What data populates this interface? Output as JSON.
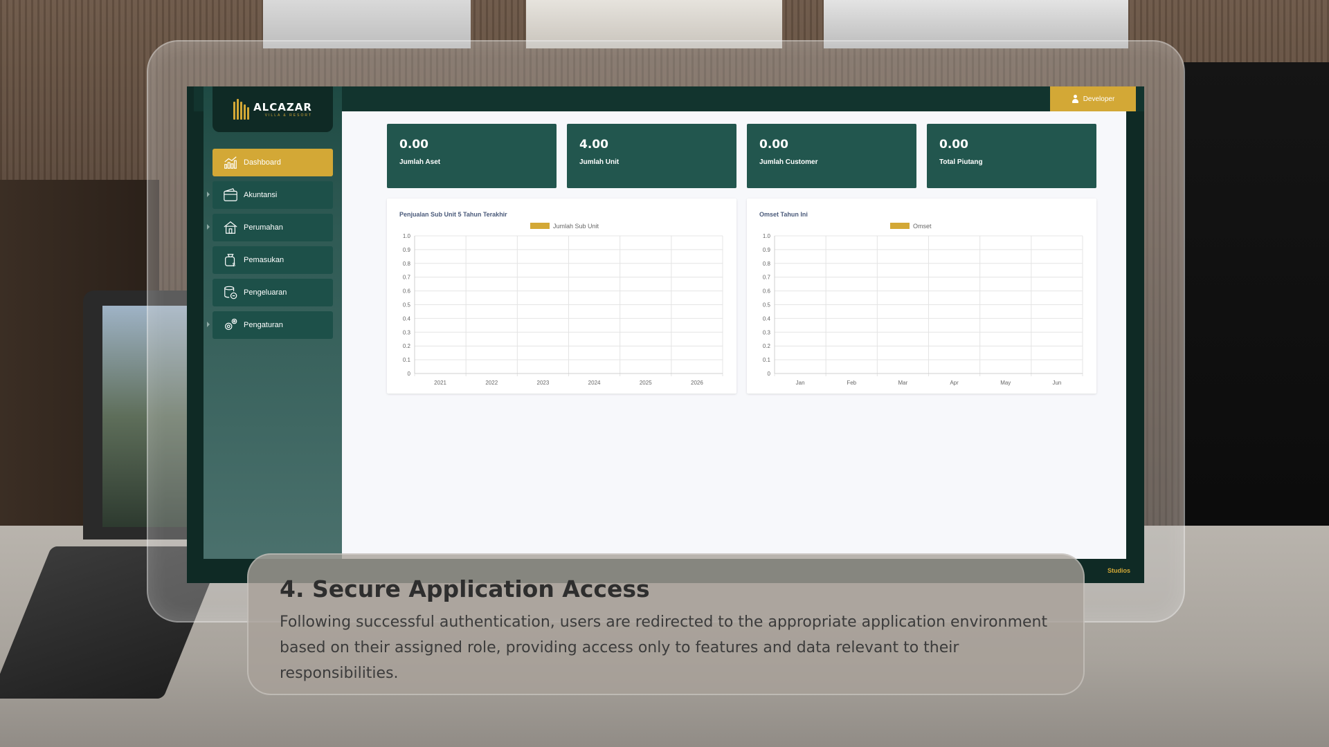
{
  "app": {
    "logo_title": "ALCAZAR",
    "logo_subtitle": "VILLA & RESORT",
    "user_label": "Developer",
    "footer_text": "Studios"
  },
  "sidebar": {
    "items": [
      {
        "label": "Dashboard",
        "icon": "dashboard-chart-icon",
        "active": true
      },
      {
        "label": "Akuntansi",
        "icon": "wallet-icon",
        "active": false
      },
      {
        "label": "Perumahan",
        "icon": "house-icon",
        "active": false
      },
      {
        "label": "Pemasukan",
        "icon": "income-bag-icon",
        "active": false
      },
      {
        "label": "Pengeluaran",
        "icon": "expense-coins-icon",
        "active": false
      },
      {
        "label": "Pengaturan",
        "icon": "gears-icon",
        "active": false
      }
    ]
  },
  "stats": [
    {
      "value": "0.00",
      "label": "Jumlah Aset"
    },
    {
      "value": "4.00",
      "label": "Jumlah Unit"
    },
    {
      "value": "0.00",
      "label": "Jumlah Customer"
    },
    {
      "value": "0.00",
      "label": "Total Piutang"
    }
  ],
  "colors": {
    "primary": "#22564e",
    "accent": "#d3a836",
    "sidebar_dark": "#0f2a25"
  },
  "chart_data": [
    {
      "type": "bar",
      "title": "Penjualan Sub Unit 5 Tahun Terakhir",
      "categories": [
        "2021",
        "2022",
        "2023",
        "2024",
        "2025",
        "2026"
      ],
      "series": [
        {
          "name": "Jumlah Sub Unit",
          "values": [
            0,
            0,
            0,
            0,
            0,
            0
          ],
          "color": "#d3a836"
        }
      ],
      "ylim": [
        0,
        1.0
      ],
      "yticks": [
        "0",
        "0.1",
        "0.2",
        "0.3",
        "0.4",
        "0.5",
        "0.6",
        "0.7",
        "0.8",
        "0.9",
        "1.0"
      ],
      "grid": true,
      "legend": "top-center"
    },
    {
      "type": "bar",
      "title": "Omset Tahun Ini",
      "categories": [
        "Jan",
        "Feb",
        "Mar",
        "Apr",
        "May",
        "Jun"
      ],
      "series": [
        {
          "name": "Omset",
          "values": [
            0,
            0,
            0,
            0,
            0,
            0
          ],
          "color": "#d3a836"
        }
      ],
      "ylim": [
        0,
        1.0
      ],
      "yticks": [
        "0",
        "0.1",
        "0.2",
        "0.3",
        "0.4",
        "0.5",
        "0.6",
        "0.7",
        "0.8",
        "0.9",
        "1.0"
      ],
      "grid": true,
      "legend": "top-center"
    }
  ],
  "caption": {
    "title": "4. Secure Application Access",
    "body": "Following successful authentication, users are redirected to the appropriate application environment based on their assigned role, providing access only to features and data relevant to their responsibilities."
  }
}
